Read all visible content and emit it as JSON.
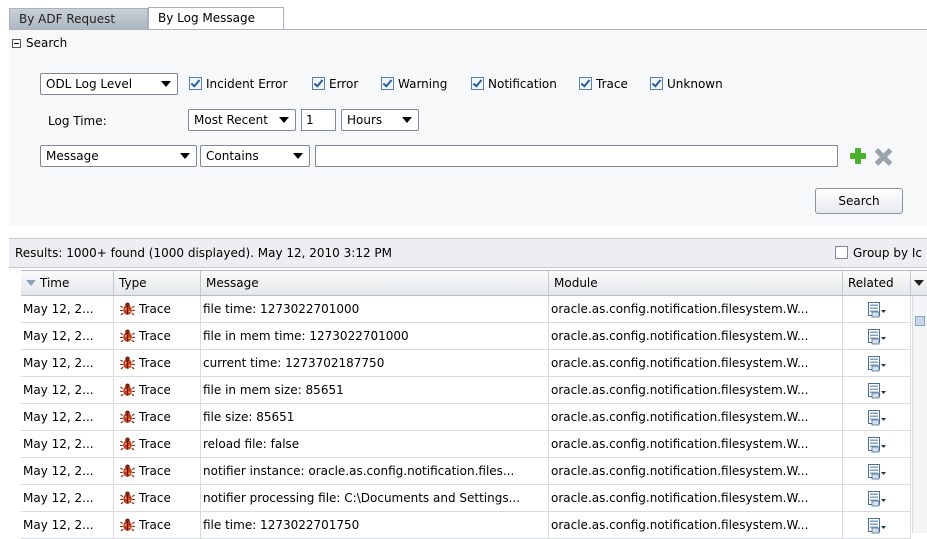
{
  "tabs": [
    {
      "label": "By ADF Request",
      "active": false
    },
    {
      "label": "By Log Message",
      "active": true
    }
  ],
  "search": {
    "section_title": "Search",
    "log_level_select": "ODL Log Level",
    "levels": [
      {
        "label": "Incident Error",
        "checked": true
      },
      {
        "label": "Error",
        "checked": true
      },
      {
        "label": "Warning",
        "checked": true
      },
      {
        "label": "Notification",
        "checked": true
      },
      {
        "label": "Trace",
        "checked": true
      },
      {
        "label": "Unknown",
        "checked": true
      }
    ],
    "log_time_label": "Log Time:",
    "log_time_mode": "Most Recent",
    "log_time_value": "1",
    "log_time_unit": "Hours",
    "field_select": "Message",
    "operator_select": "Contains",
    "query_value": "",
    "search_button": "Search"
  },
  "results": {
    "summary": "Results:  1000+ found (1000 displayed). May 12, 2010 3:12 PM",
    "group_by_label": "Group by Ic"
  },
  "table": {
    "columns": [
      "Time",
      "Type",
      "Message",
      "Module",
      "Related"
    ],
    "rows": [
      {
        "time": "May 12, 2...",
        "type": "Trace",
        "message": "file time: 1273022701000",
        "module": "oracle.as.config.notification.filesystem.W..."
      },
      {
        "time": "May 12, 2...",
        "type": "Trace",
        "message": "file in mem time: 1273022701000",
        "module": "oracle.as.config.notification.filesystem.W..."
      },
      {
        "time": "May 12, 2...",
        "type": "Trace",
        "message": "current time: 1273702187750",
        "module": "oracle.as.config.notification.filesystem.W..."
      },
      {
        "time": "May 12, 2...",
        "type": "Trace",
        "message": "file in mem size: 85651",
        "module": "oracle.as.config.notification.filesystem.W..."
      },
      {
        "time": "May 12, 2...",
        "type": "Trace",
        "message": "file size: 85651",
        "module": "oracle.as.config.notification.filesystem.W..."
      },
      {
        "time": "May 12, 2...",
        "type": "Trace",
        "message": "reload file: false",
        "module": "oracle.as.config.notification.filesystem.W..."
      },
      {
        "time": "May 12, 2...",
        "type": "Trace",
        "message": "notifier instance: oracle.as.config.notification.files...",
        "module": "oracle.as.config.notification.filesystem.W..."
      },
      {
        "time": "May 12, 2...",
        "type": "Trace",
        "message": "notifier processing file: C:\\Documents and Settings...",
        "module": "oracle.as.config.notification.filesystem.W..."
      },
      {
        "time": "May 12, 2...",
        "type": "Trace",
        "message": "file time: 1273022701750",
        "module": "oracle.as.config.notification.filesystem.W..."
      }
    ]
  },
  "icons": {
    "type_icon": "bug-icon",
    "related_icon": "related-menu-icon",
    "add_condition": "add-icon",
    "remove_condition": "remove-icon"
  },
  "colors": {
    "panel_bg": "#f7f8fa",
    "add_green": "#4caf2e",
    "bug_red": "#c43c1f"
  }
}
